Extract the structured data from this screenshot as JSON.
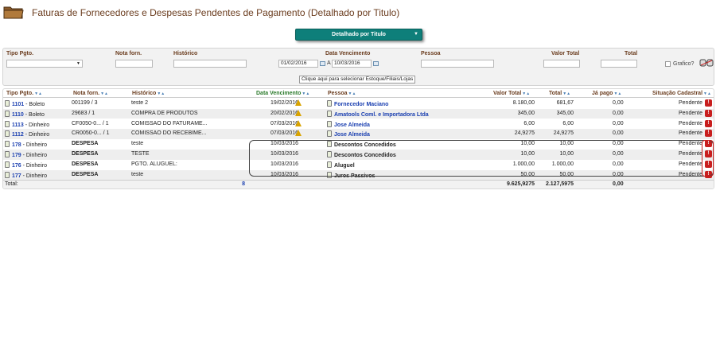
{
  "header": {
    "icon": "folder-icon",
    "title": "Faturas de Fornecedores e Despesas Pendentes de Pagamento (Detalhado por Titulo)"
  },
  "view_select": {
    "value": "Detalhado por Titulo"
  },
  "filters": {
    "tipo_pgto_label": "Tipo Pgto.",
    "nota_label": "Nota forn.",
    "historico_label": "Histórico",
    "data_venc_label": "Data Vencimento",
    "data_from": "01/02/2016",
    "separator": "A",
    "data_to": "10/03/2016",
    "pessoa_label": "Pessoa",
    "valor_total_label": "Valor Total",
    "total_label": "Total",
    "grafico_label": "Grafico?",
    "estoque_button": "Clique aqui para selecionar Estoque/Filiais/Lojas"
  },
  "table": {
    "columns": {
      "tipo": "Tipo Pgto.",
      "nota": "Nota forn.",
      "historico": "Histórico",
      "data": "Data Vencimento",
      "pessoa": "Pessoa",
      "valor_total": "Valor Total",
      "total": "Total",
      "ja_pago": "Já pago",
      "situacao": "Situação Cadastral"
    },
    "rows": [
      {
        "id": "1101",
        "tipo": " - Boleto",
        "nota": "001199 / 3",
        "historico": "teste 2",
        "data": "19/02/2016",
        "pessoa": "Fornecedor Maciano",
        "valor_total": "8.180,00",
        "total": "681,67",
        "ja_pago": "0,00",
        "situacao": "Pendente"
      },
      {
        "id": "1110",
        "tipo": " - Boleto",
        "nota": "29683 / 1",
        "historico": "COMPRA DE PRODUTOS",
        "data": "20/02/2016",
        "pessoa": "Amatools Coml. e Importadora Ltda",
        "valor_total": "345,00",
        "total": "345,00",
        "ja_pago": "0,00",
        "situacao": "Pendente"
      },
      {
        "id": "1113",
        "tipo": " - Dinheiro",
        "nota": "CF0050-0... / 1",
        "historico": "COMISSAO DO FATURAME...",
        "data": "07/03/2016",
        "pessoa": "Jose Almeida",
        "valor_total": "6,00",
        "total": "6,00",
        "ja_pago": "0,00",
        "situacao": "Pendente"
      },
      {
        "id": "1112",
        "tipo": " - Dinheiro",
        "nota": "CR0050-0... / 1",
        "historico": "COMISSAO DO RECEBIME...",
        "data": "07/03/2016",
        "pessoa": "Jose Almeida",
        "valor_total": "24,9275",
        "total": "24,9275",
        "ja_pago": "0,00",
        "situacao": "Pendente"
      },
      {
        "id": "178",
        "tipo": " - Dinheiro",
        "nota": "DESPESA",
        "historico": "teste",
        "data": "10/03/2016",
        "pessoa": "Descontos Concedidos",
        "valor_total": "10,00",
        "total": "10,00",
        "ja_pago": "0,00",
        "situacao": "Pendente"
      },
      {
        "id": "179",
        "tipo": " - Dinheiro",
        "nota": "DESPESA",
        "historico": "TESTE",
        "data": "10/03/2016",
        "pessoa": "Descontos Concedidos",
        "valor_total": "10,00",
        "total": "10,00",
        "ja_pago": "0,00",
        "situacao": "Pendente"
      },
      {
        "id": "176",
        "tipo": " - Dinheiro",
        "nota": "DESPESA",
        "historico": "PGTO. ALUGUEL:",
        "data": "10/03/2016",
        "pessoa": "Aluguel",
        "valor_total": "1.000,00",
        "total": "1.000,00",
        "ja_pago": "0,00",
        "situacao": "Pendente"
      },
      {
        "id": "177",
        "tipo": " - Dinheiro",
        "nota": "DESPESA",
        "historico": "teste",
        "data": "10/03/2016",
        "pessoa": "Juros Passivos",
        "valor_total": "50,00",
        "total": "50,00",
        "ja_pago": "0,00",
        "situacao": "Pendente"
      }
    ],
    "totals": {
      "label": "Total:",
      "count": "8",
      "valor_total": "9.625,9275",
      "total": "2.127,5975",
      "ja_pago": "0,00"
    }
  },
  "colors": {
    "title": "#6b3d1f",
    "accent": "#0e7f7a",
    "link": "#1a3fb0",
    "pending": "#c81e1e"
  }
}
